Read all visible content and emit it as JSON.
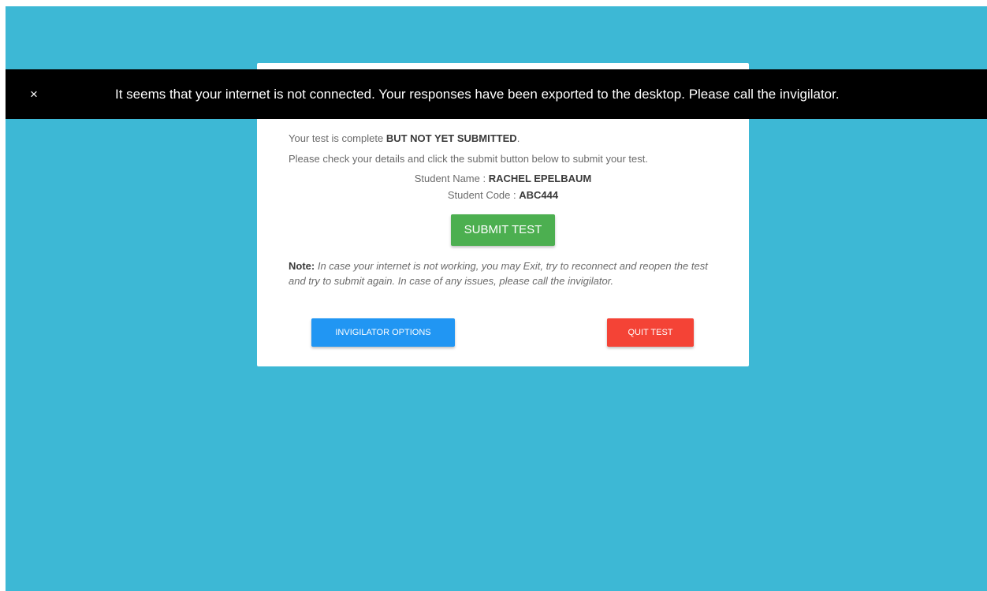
{
  "banner": {
    "close_glyph": "×",
    "message": "It seems that your internet is not connected. Your responses have been exported to the desktop. Please call the invigilator."
  },
  "card": {
    "status_prefix": "Your test is complete ",
    "status_emphasis": "BUT NOT YET SUBMITTED",
    "status_suffix": ".",
    "instruction": "Please check your details and click the submit button below to submit your test.",
    "student_name_label": "Student Name : ",
    "student_name": "RACHEL EPELBAUM",
    "student_code_label": "Student Code : ",
    "student_code": "ABC444",
    "submit_label": "SUBMIT TEST",
    "note_label": "Note:",
    "note_text": " In case your internet is not working, you may Exit, try to reconnect and reopen the test and try to submit again. In case of any issues, please call the invigilator.",
    "invigilator_label": "INVIGILATOR OPTIONS",
    "quit_label": "QUIT TEST"
  },
  "colors": {
    "background": "#3db8d5",
    "submit": "#4caf50",
    "invigilator": "#2196f3",
    "quit": "#f44336",
    "banner": "#000000"
  }
}
